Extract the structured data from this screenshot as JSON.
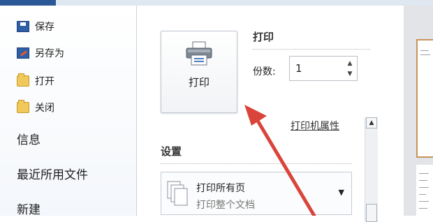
{
  "nav": {
    "items": [
      {
        "label": "保存",
        "icon": "save-icon"
      },
      {
        "label": "另存为",
        "icon": "save-as-icon"
      },
      {
        "label": "打开",
        "icon": "open-folder-icon"
      },
      {
        "label": "关闭",
        "icon": "close-folder-icon"
      }
    ],
    "big_items": [
      "信息",
      "最近所用文件",
      "新建"
    ]
  },
  "print": {
    "section_title": "打印",
    "button_label": "打印",
    "copies_label": "份数:",
    "copies_value": "1",
    "printer_properties": "打印机属性"
  },
  "settings": {
    "title": "设置",
    "dropdown_main": "打印所有页",
    "dropdown_sub": "打印整个文档"
  },
  "colors": {
    "accent": "#2b5797",
    "arrow": "#d9443b"
  }
}
